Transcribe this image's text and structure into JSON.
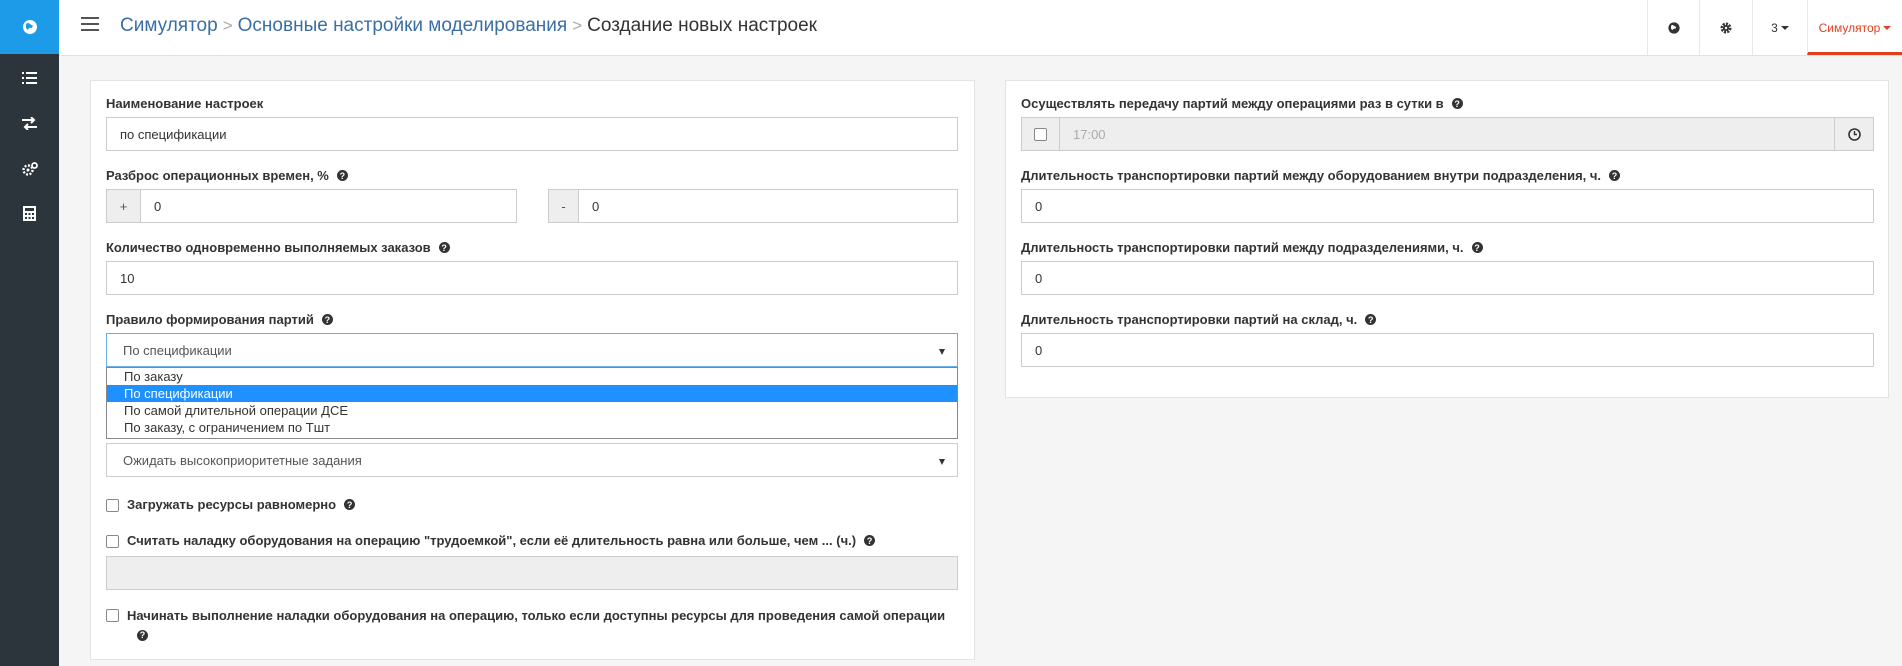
{
  "breadcrumb": {
    "item1": "Симулятор",
    "item2": "Основные настройки моделирования",
    "current": "Создание новых настроек"
  },
  "topbar": {
    "lang_icon": "globe-icon",
    "settings_icon": "gear-icon",
    "number_menu": "3",
    "user_menu": "Симулятор"
  },
  "sidebar": {
    "logo_icon": "globe-icon",
    "items": [
      "list-icon",
      "exchange-icon",
      "cogs-icon",
      "calculator-icon"
    ]
  },
  "form": {
    "name_label": "Наименование настроек",
    "name_value": "по  спецификации",
    "spread_label": "Разброс операционных времен, %",
    "spread_plus_addon": "+",
    "spread_plus_value": "0",
    "spread_minus_addon": "-",
    "spread_minus_value": "0",
    "orders_label": "Количество одновременно выполняемых заказов",
    "orders_value": "10",
    "batch_rule_label": "Правило формирования партий",
    "batch_rule_value": "По спецификации",
    "batch_rule_options": [
      "По заказу",
      "По спецификации",
      "По самой длительной операции ДСЕ",
      "По заказу, с ограничением по Тшт"
    ],
    "priority_value": "Ожидать высокоприоритетные задания",
    "load_evenly_label": "Загружать ресурсы равномерно",
    "setup_labor_label": "Считать наладку оборудования на операцию \"трудоемкой\", если её длительность равна или больше, чем ... (ч.)",
    "setup_labor_value": "",
    "start_setup_label": "Начинать выполнение наладки оборудования на операцию, только если доступны ресурсы для проведения самой операции"
  },
  "right": {
    "transfer_label": "Осуществлять передачу партий между операциями раз в сутки в",
    "transfer_time": "17:00",
    "transport_inside_label": "Длительность транспортировки партий между оборудованием внутри подразделения, ч.",
    "transport_inside_value": "0",
    "transport_between_label": "Длительность транспортировки партий между подразделениями, ч.",
    "transport_between_value": "0",
    "transport_stock_label": "Длительность транспортировки партий на склад, ч.",
    "transport_stock_value": "0"
  },
  "colors": {
    "accent": "#1e9be8",
    "sidebar": "#2d353c",
    "active_tab": "#e04020",
    "selected_option": "#1e90ff"
  }
}
